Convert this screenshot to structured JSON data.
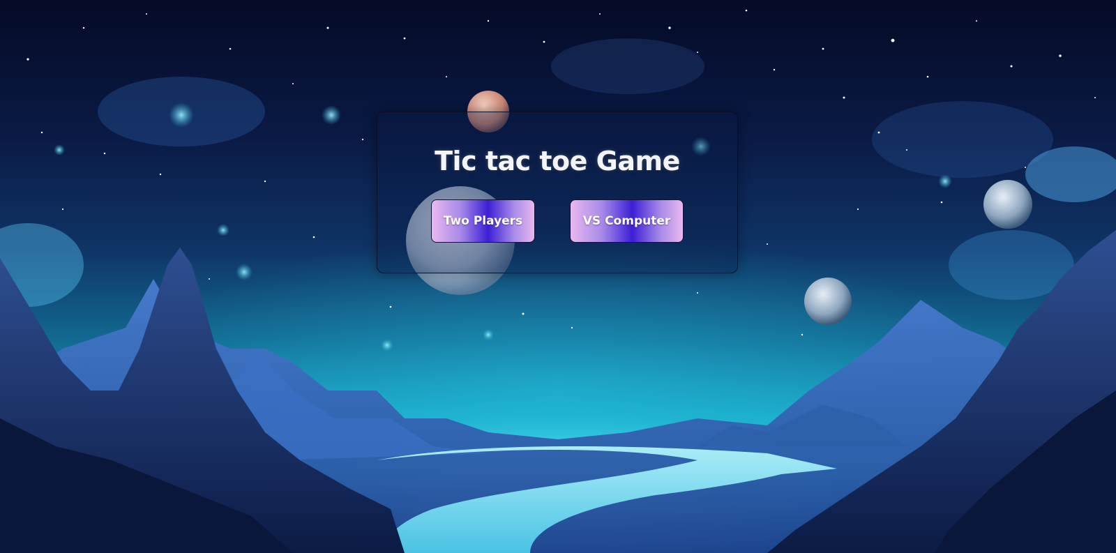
{
  "page": {
    "title": "Tic tac toe Game"
  },
  "menu": {
    "two_players_label": "Two Players",
    "vs_computer_label": "VS Computer"
  },
  "colors": {
    "button_gradient_edge": "#eab8f0",
    "button_gradient_center": "#3d1fd6",
    "title_text": "#f4f5fb",
    "panel_border": "#0b0f25"
  }
}
